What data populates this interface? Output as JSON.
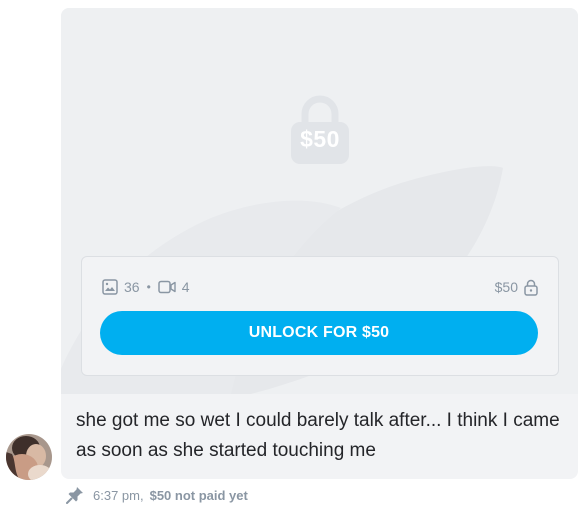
{
  "message": {
    "locked_price_overlay": "$50",
    "media": {
      "photo_count": "36",
      "separator": "•",
      "video_count": "4"
    },
    "price_label": "$50",
    "unlock_button_label": "UNLOCK FOR $50",
    "text": "she got me so wet I could barely talk after... I think I came as soon as she started touching me",
    "meta": {
      "time": "6:37 pm,",
      "payment_status": "$50 not paid yet"
    }
  },
  "colors": {
    "accent": "#00aff0",
    "muted": "#8a96a3",
    "card_bg": "#f2f3f5",
    "text": "#242529"
  },
  "icons": [
    "lock-icon",
    "image-icon",
    "video-icon",
    "small-lock-icon",
    "pin-icon"
  ]
}
